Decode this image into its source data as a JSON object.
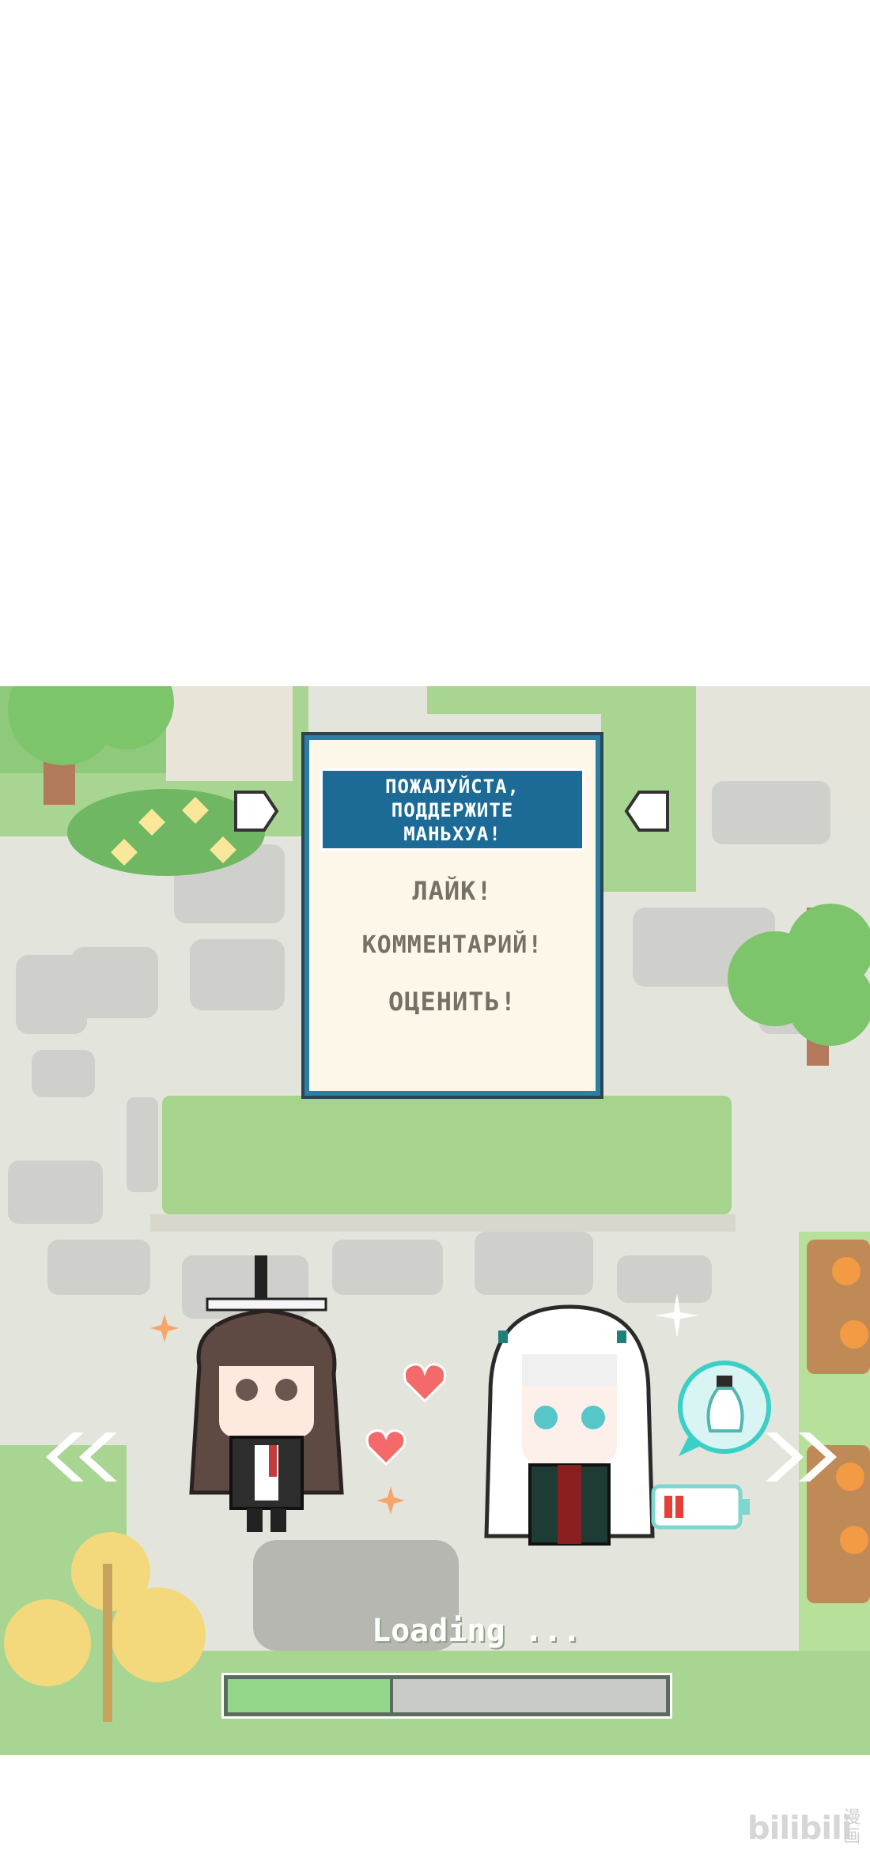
{
  "panel": {
    "header_lines": [
      "ПОЖАЛУЙСТА,",
      "ПОДДЕРЖИТЕ",
      "МАНЬХУА!"
    ],
    "items": [
      "ЛАЙК!",
      "КОММЕНТАРИЙ!",
      "ОЦЕНИТЬ!"
    ]
  },
  "loading": {
    "text": "Loading ...",
    "progress": 0.37
  },
  "watermark": {
    "logo": "bilibili",
    "sub": "漫画"
  },
  "icons": {
    "left_nav": "double-chevron-left",
    "right_nav": "double-chevron-right",
    "thought": "bottle-speech-bubble",
    "battery": "low-battery",
    "hearts": "heart"
  },
  "colors": {
    "panel_border": "#2b7fa5",
    "panel_header": "#1b6b96",
    "progress_fill": "#94d689",
    "grass": "#95cf7f"
  }
}
